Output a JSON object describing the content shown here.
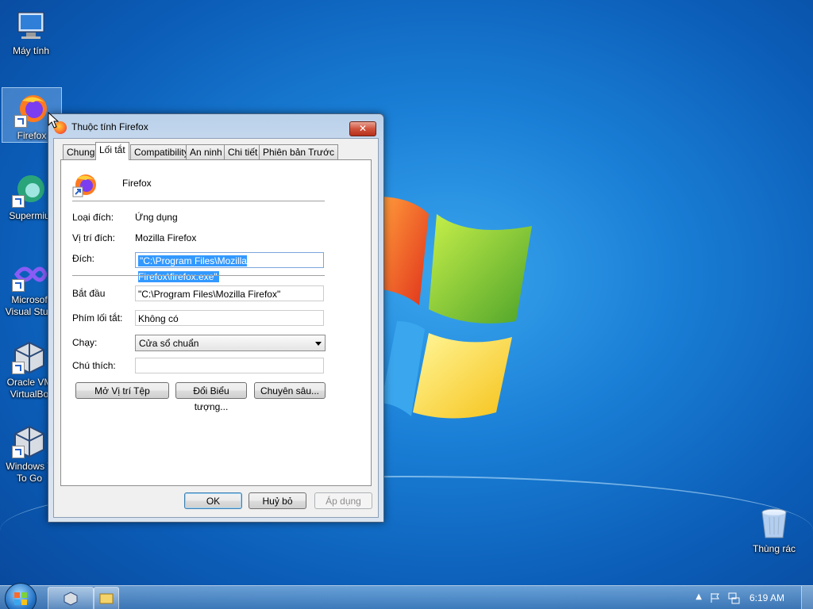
{
  "desktop": {
    "icons": [
      {
        "label": "Máy tính",
        "icon": "computer-icon"
      },
      {
        "label": "Firefox",
        "icon": "firefox-icon"
      },
      {
        "label": "Supermiu",
        "icon": "supermium-icon"
      },
      {
        "label": "Microsof",
        "label2": "Visual Stud",
        "icon": "visual-studio-icon"
      },
      {
        "label": "Oracle VM",
        "label2": "VirtualBo",
        "icon": "virtualbox-icon"
      },
      {
        "label": "Windows T",
        "label2": "To Go",
        "icon": "windows-to-go-icon"
      },
      {
        "label": "Thùng rác",
        "icon": "recycle-bin-icon"
      }
    ]
  },
  "dialog": {
    "title": "Thuộc tính Firefox",
    "close_label": "✕",
    "tabs": [
      {
        "label": "Chung"
      },
      {
        "label": "Lối tắt"
      },
      {
        "label": "Compatibility"
      },
      {
        "label": "An ninh"
      },
      {
        "label": "Chi tiết"
      },
      {
        "label": "Phiên bản Trước"
      }
    ],
    "active_tab": "Lối tắt",
    "app_name": "Firefox",
    "target_type_label": "Loại đích:",
    "target_type_value": "Ứng dụng",
    "target_location_label": "Vị trí đích:",
    "target_location_value": "Mozilla Firefox",
    "target_label": "Đích:",
    "target_value": "\"C:\\Program Files\\Mozilla Firefox\\firefox.exe\"",
    "start_in_label": "Bắt đầu",
    "start_in_value": "\"C:\\Program Files\\Mozilla Firefox\"",
    "shortcut_key_label": "Phím lối tắt:",
    "shortcut_key_value": "Không có",
    "run_label": "Chạy:",
    "run_value": "Cửa sổ chuẩn",
    "comment_label": "Chú thích:",
    "comment_value": "",
    "open_location_button": "Mở Vị trí Tệp",
    "change_icon_button": "Đổi Biểu tượng...",
    "advanced_button": "Chuyên sâu...",
    "ok_button": "OK",
    "cancel_button": "Huỷ bỏ",
    "apply_button": "Áp dụng"
  },
  "taskbar": {
    "clock": "6:19 AM"
  }
}
